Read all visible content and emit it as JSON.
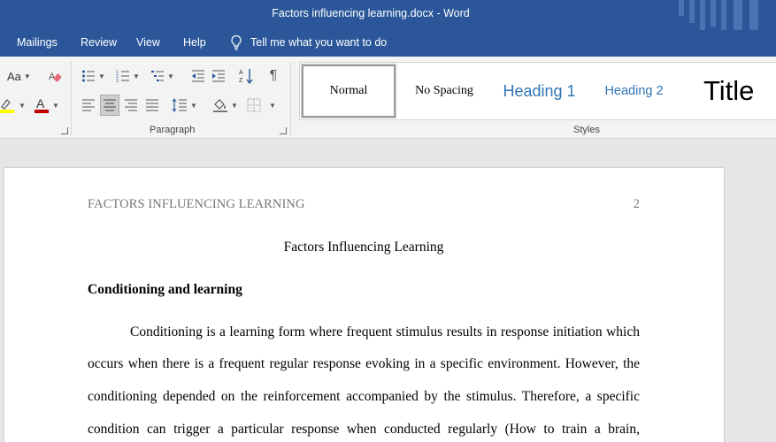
{
  "window": {
    "title": "Factors influencing learning.docx  -  Word"
  },
  "menu": {
    "items": [
      "Mailings",
      "Review",
      "View",
      "Help"
    ],
    "tell_me": "Tell me what you want to do"
  },
  "ribbon": {
    "font_group": {
      "change_case_label": "Aa"
    },
    "paragraph_label": "Paragraph",
    "styles_label": "Styles",
    "styles": [
      "Normal",
      "No Spacing",
      "Heading 1",
      "Heading 2",
      "Title"
    ]
  },
  "colors": {
    "brand": "#2b579a",
    "heading_style": "#2e74b5",
    "highlight": "#ffff00",
    "font_color": "#c00000"
  },
  "document": {
    "running_head": "FACTORS INFLUENCING LEARNING",
    "page_number": "2",
    "title": "Factors Influencing Learning",
    "section_heading": "Conditioning and learning",
    "paragraph_lines": [
      "Conditioning is a learning form where frequent stimulus results in response initiation which",
      "occurs when there is a frequent regular response evoking in a specific environment. However, the",
      "conditioning depended on the reinforcement accompanied by the stimulus. Therefore, a specific",
      "condition can trigger a particular response when conducted regularly (How to train a brain,"
    ]
  }
}
